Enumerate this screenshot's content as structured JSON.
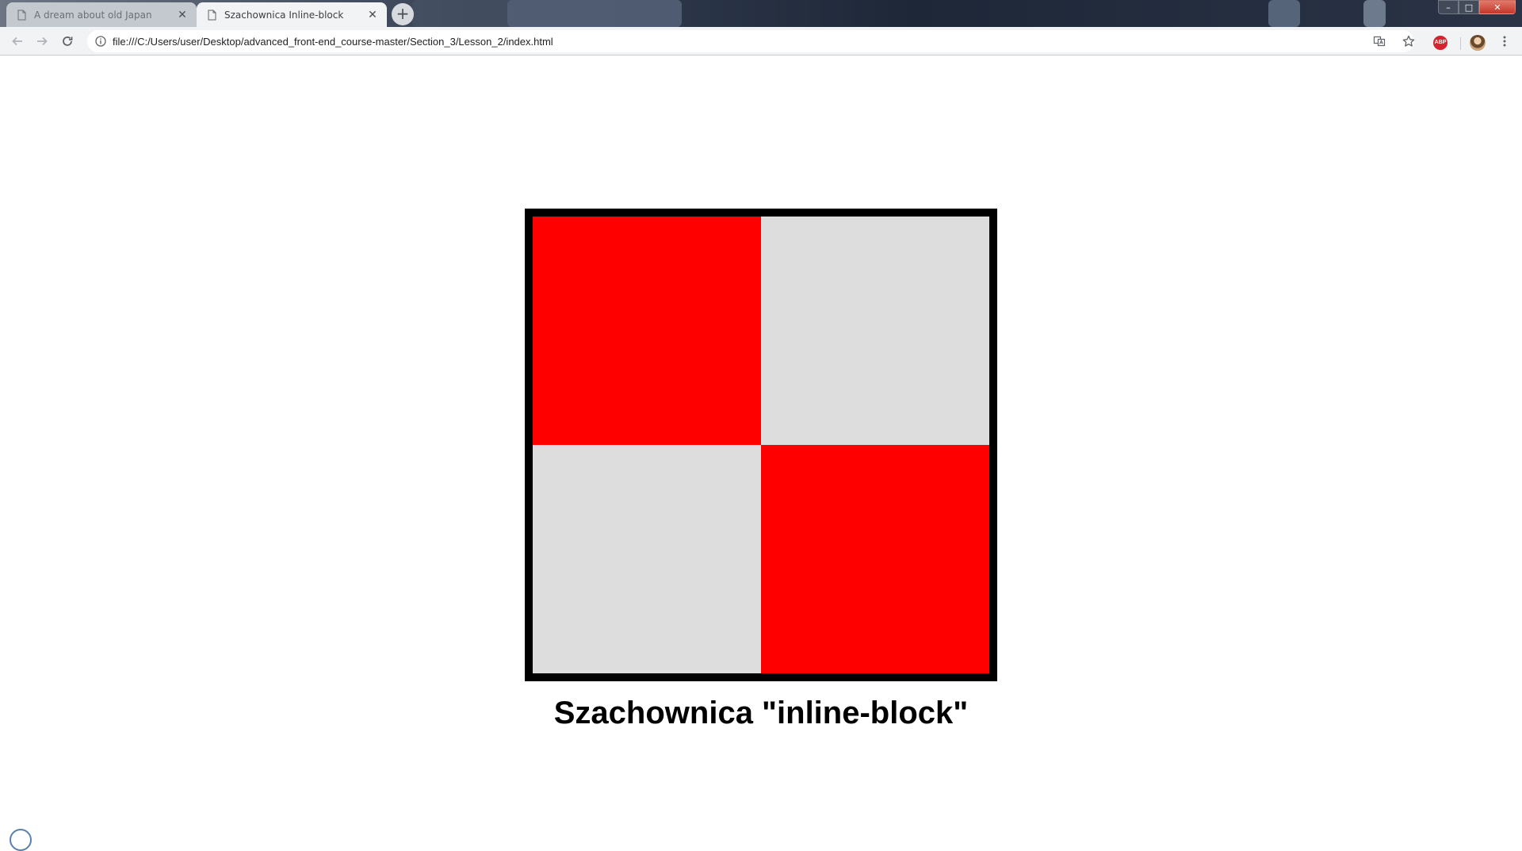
{
  "browser": {
    "tabs": [
      {
        "title": "A dream about old Japan",
        "active": false
      },
      {
        "title": "Szachownica Inline-block",
        "active": true
      }
    ],
    "tab_close_glyph": "✕",
    "new_tab_glyph": "+",
    "window_controls": {
      "minimize": "–",
      "maximize": "□",
      "close": "✕"
    },
    "address_url": "file:///C:/Users/user/Desktop/advanced_front-end_course-master/Section_3/Lesson_2/index.html",
    "extension_abp_label": "ABP",
    "icons": [
      "page-icon",
      "close-icon",
      "plus-icon",
      "back-arrow-icon",
      "forward-arrow-icon",
      "reload-icon",
      "info-icon",
      "translate-icon",
      "star-icon",
      "adblock-icon",
      "profile-avatar-icon",
      "more-vert-icon"
    ]
  },
  "page": {
    "heading": "Szachownica \"inline-block\"",
    "board": {
      "cells": [
        "red",
        "grey",
        "grey",
        "red"
      ],
      "colors": {
        "red": "#ff0000",
        "grey": "#dddddd",
        "border": "#000000"
      }
    }
  }
}
